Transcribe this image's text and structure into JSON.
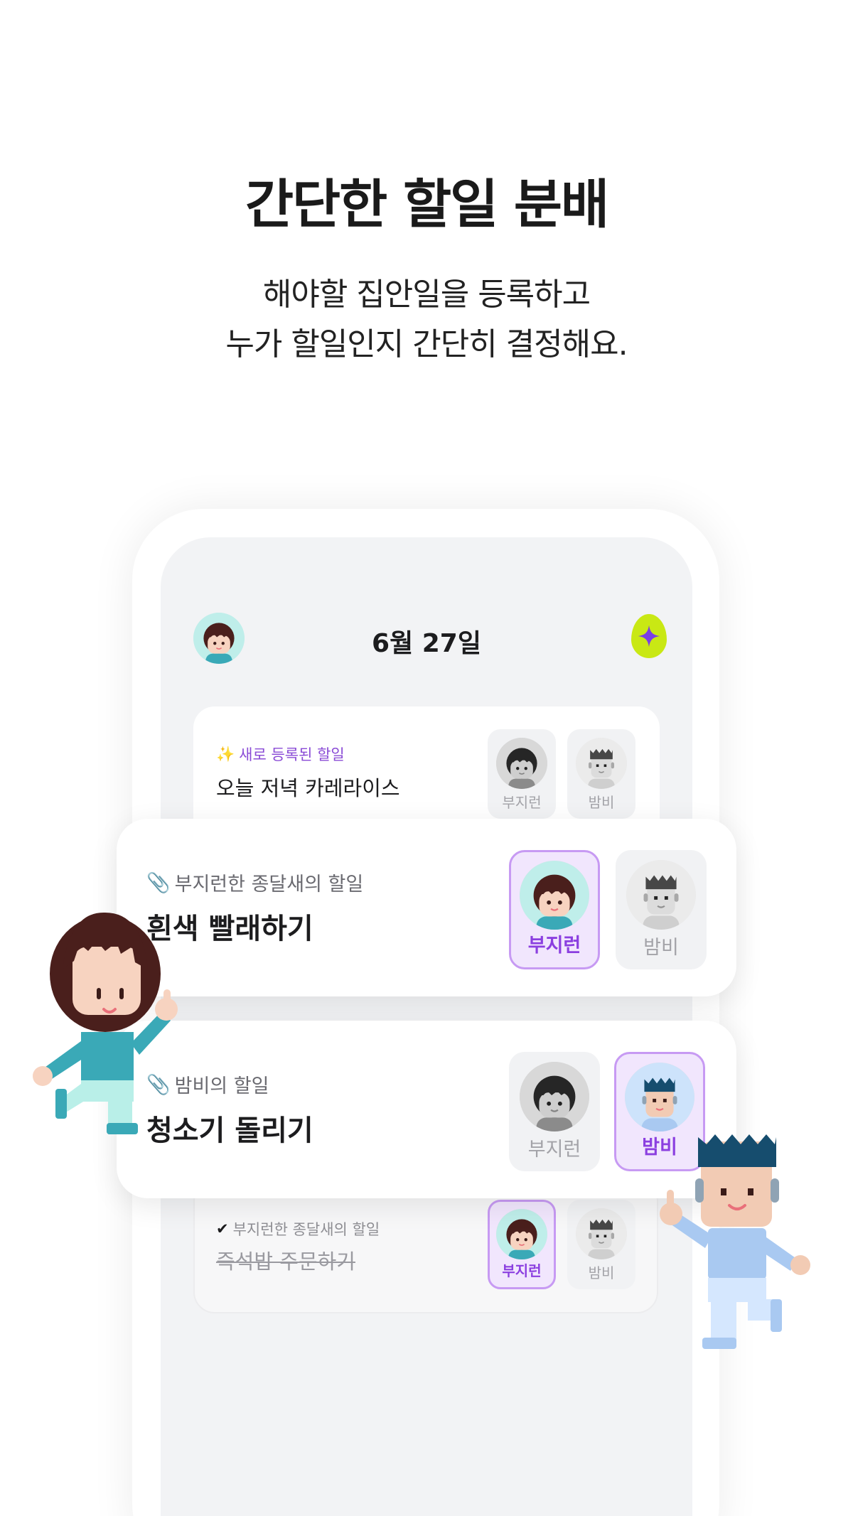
{
  "header": {
    "title": "간단한 할일 분배",
    "subtitle_line1": "해야할 집안일을 등록하고",
    "subtitle_line2": "누가 할일인지 간단히 결정해요."
  },
  "app": {
    "date": "6월 27일",
    "egg_icon": "sparkle-egg-icon",
    "accent_color": "#8b3fe0",
    "egg_color": "#c9e814"
  },
  "cards": [
    {
      "tag_icon": "sparkle-icon",
      "tag_glyph": "✨",
      "tag": "새로 등록된 할일",
      "task": "오늘 저녁 카레라이스",
      "assignees": [
        {
          "name": "부지런",
          "selected": false
        },
        {
          "name": "밤비",
          "selected": false
        }
      ]
    },
    {
      "tag_icon": "paperclip-icon",
      "tag_glyph": "📎",
      "tag": "부지런한 종달새의 할일",
      "task": "흰색 빨래하기",
      "assignees": [
        {
          "name": "부지런",
          "selected": true
        },
        {
          "name": "밤비",
          "selected": false
        }
      ]
    },
    {
      "tag_icon": "paperclip-icon",
      "tag_glyph": "📎",
      "tag": "밤비의 할일",
      "task": "청소기 돌리기",
      "assignees": [
        {
          "name": "부지런",
          "selected": false
        },
        {
          "name": "밤비",
          "selected": true
        }
      ]
    },
    {
      "tag_icon": "check-icon",
      "tag_glyph": "✔",
      "tag": "부지런한 종달새의 할일",
      "task": "즉석밥 주문하기",
      "done": true,
      "assignees": [
        {
          "name": "부지런",
          "selected": true
        },
        {
          "name": "밤비",
          "selected": false
        }
      ]
    }
  ]
}
